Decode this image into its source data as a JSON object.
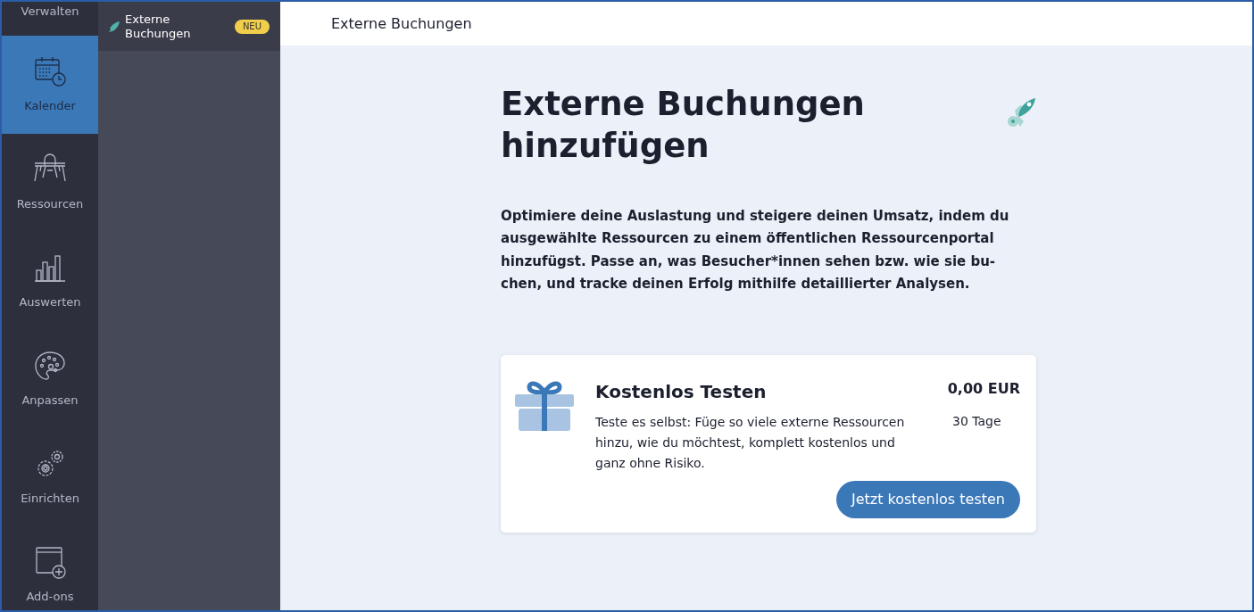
{
  "rail": {
    "items": [
      {
        "label": "Verwalten",
        "kind": "plain",
        "selected": false
      },
      {
        "label": "Kalender",
        "kind": "calendar",
        "selected": true
      },
      {
        "label": "Ressourcen",
        "kind": "desk",
        "selected": false
      },
      {
        "label": "Auswerten",
        "kind": "chart",
        "selected": false
      },
      {
        "label": "Anpassen",
        "kind": "palette",
        "selected": false
      },
      {
        "label": "Einrichten",
        "kind": "gears",
        "selected": false
      },
      {
        "label": "Add-ons",
        "kind": "addon",
        "selected": false
      }
    ]
  },
  "subnav": {
    "items": [
      {
        "label": "Externe Buchungen",
        "badge": "NEU",
        "selected": true
      }
    ]
  },
  "header": {
    "title": "Externe Buchungen"
  },
  "main": {
    "title": "Externe Buchungen hinzufügen",
    "intro": "Optimiere deine Auslastung und steigere deinen Umsatz, indem du ausgewählte Ressourcen zu einem öffentlichen Ressourcenportal hinzufügst. Passe an, was Besucher*innen sehen bzw. wie sie bu-chen, und tracke deinen Erfolg mithilfe detaillierter Analysen.",
    "plan": {
      "title": "Kostenlos Testen",
      "description": "Teste es selbst: Füge so viele externe Ressourcen hinzu, wie du möchtest, komplett kostenlos und ganz ohne Risiko.",
      "price": "0,00 EUR",
      "duration": "30 Tage",
      "button": "Jetzt kostenlos testen"
    }
  }
}
